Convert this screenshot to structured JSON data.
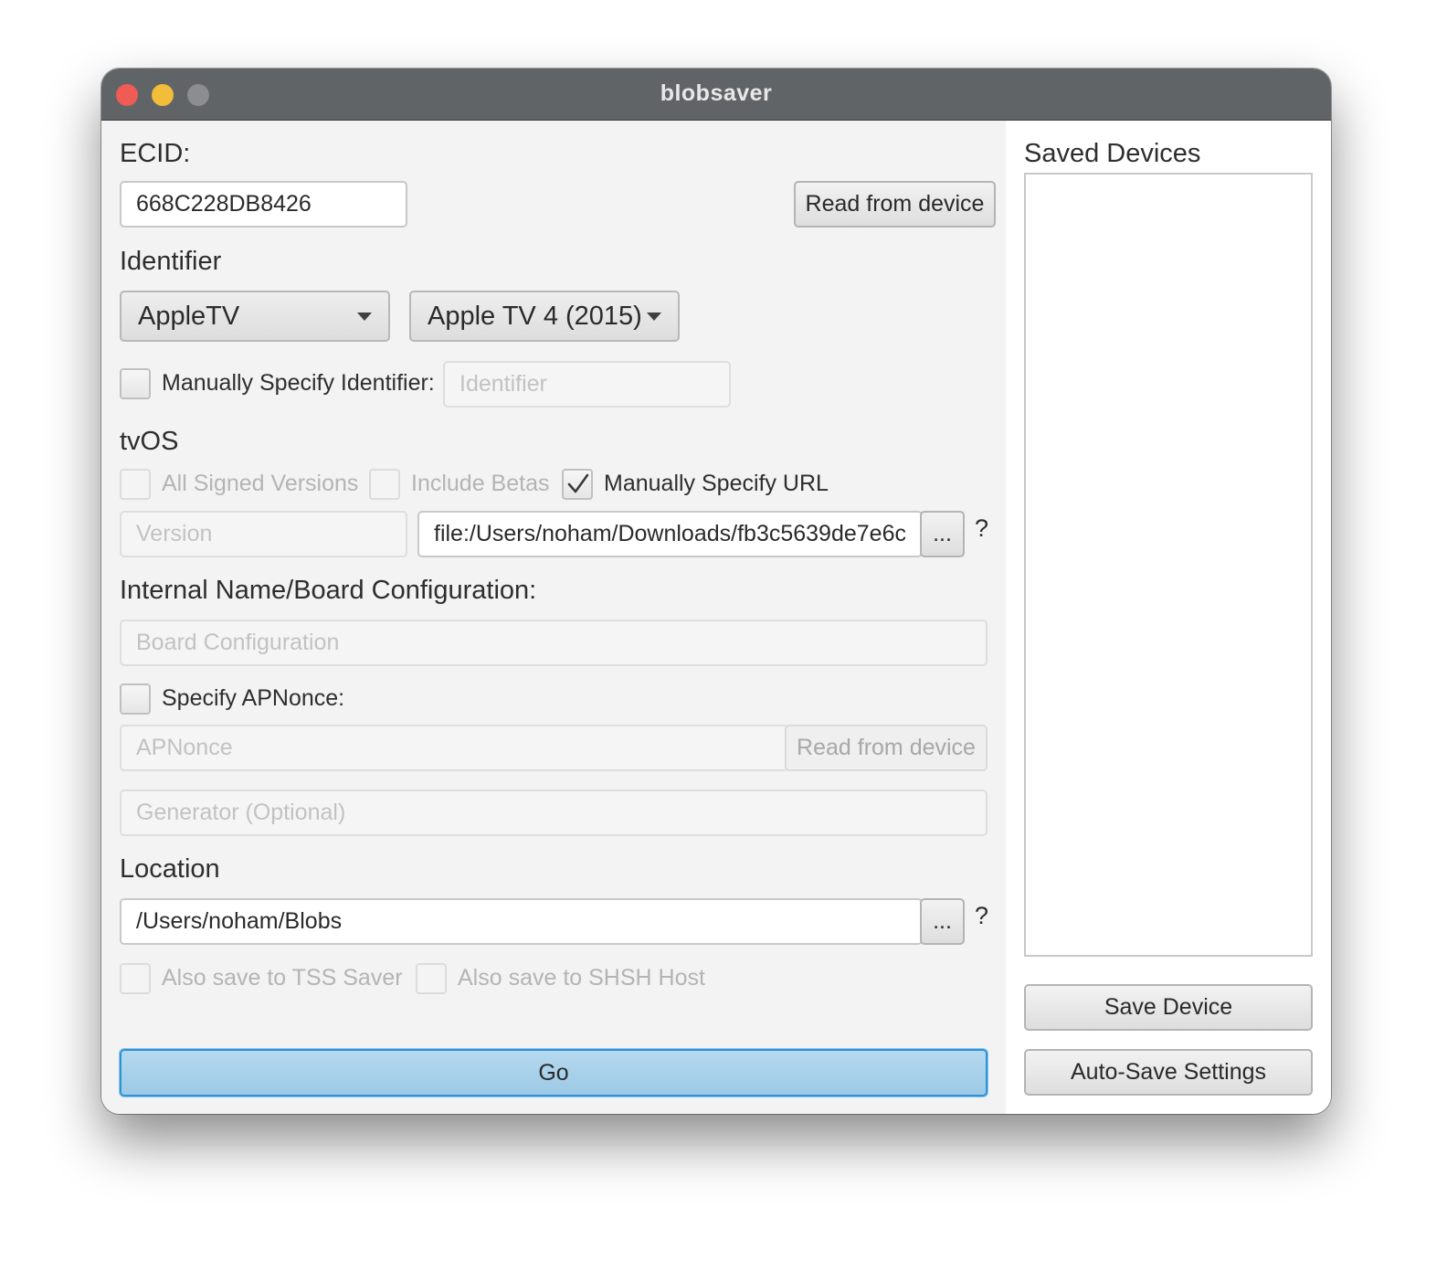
{
  "window": {
    "title": "blobsaver"
  },
  "ecid": {
    "label": "ECID:",
    "value": "668C228DB8426",
    "read_button": "Read from device"
  },
  "identifier": {
    "label": "Identifier",
    "device_type": "AppleTV",
    "device_model": "Apple TV 4 (2015)",
    "manual_label": "Manually Specify Identifier:",
    "manual_checked": false,
    "manual_placeholder": "Identifier"
  },
  "os": {
    "label": "tvOS",
    "all_signed_label": "All Signed Versions",
    "include_betas_label": "Include Betas",
    "manual_url_label": "Manually Specify URL",
    "manual_url_checked": true,
    "version_placeholder": "Version",
    "url_value": "file:/Users/noham/Downloads/fb3c5639de7e6c",
    "browse_button": "...",
    "help": "?"
  },
  "board": {
    "label": "Internal Name/Board Configuration:",
    "placeholder": "Board Configuration"
  },
  "apnonce": {
    "label": "Specify APNonce:",
    "checked": false,
    "placeholder": "APNonce",
    "read_button": "Read from device",
    "generator_placeholder": "Generator (Optional)"
  },
  "location": {
    "label": "Location",
    "value": "/Users/noham/Blobs",
    "browse_button": "...",
    "help": "?",
    "tss_saver_label": "Also save to TSS Saver",
    "shsh_host_label": "Also save to SHSH Host"
  },
  "go_button": "Go",
  "sidebar": {
    "title": "Saved Devices",
    "devices": [],
    "save_device_button": "Save Device",
    "auto_save_button": "Auto-Save Settings"
  }
}
